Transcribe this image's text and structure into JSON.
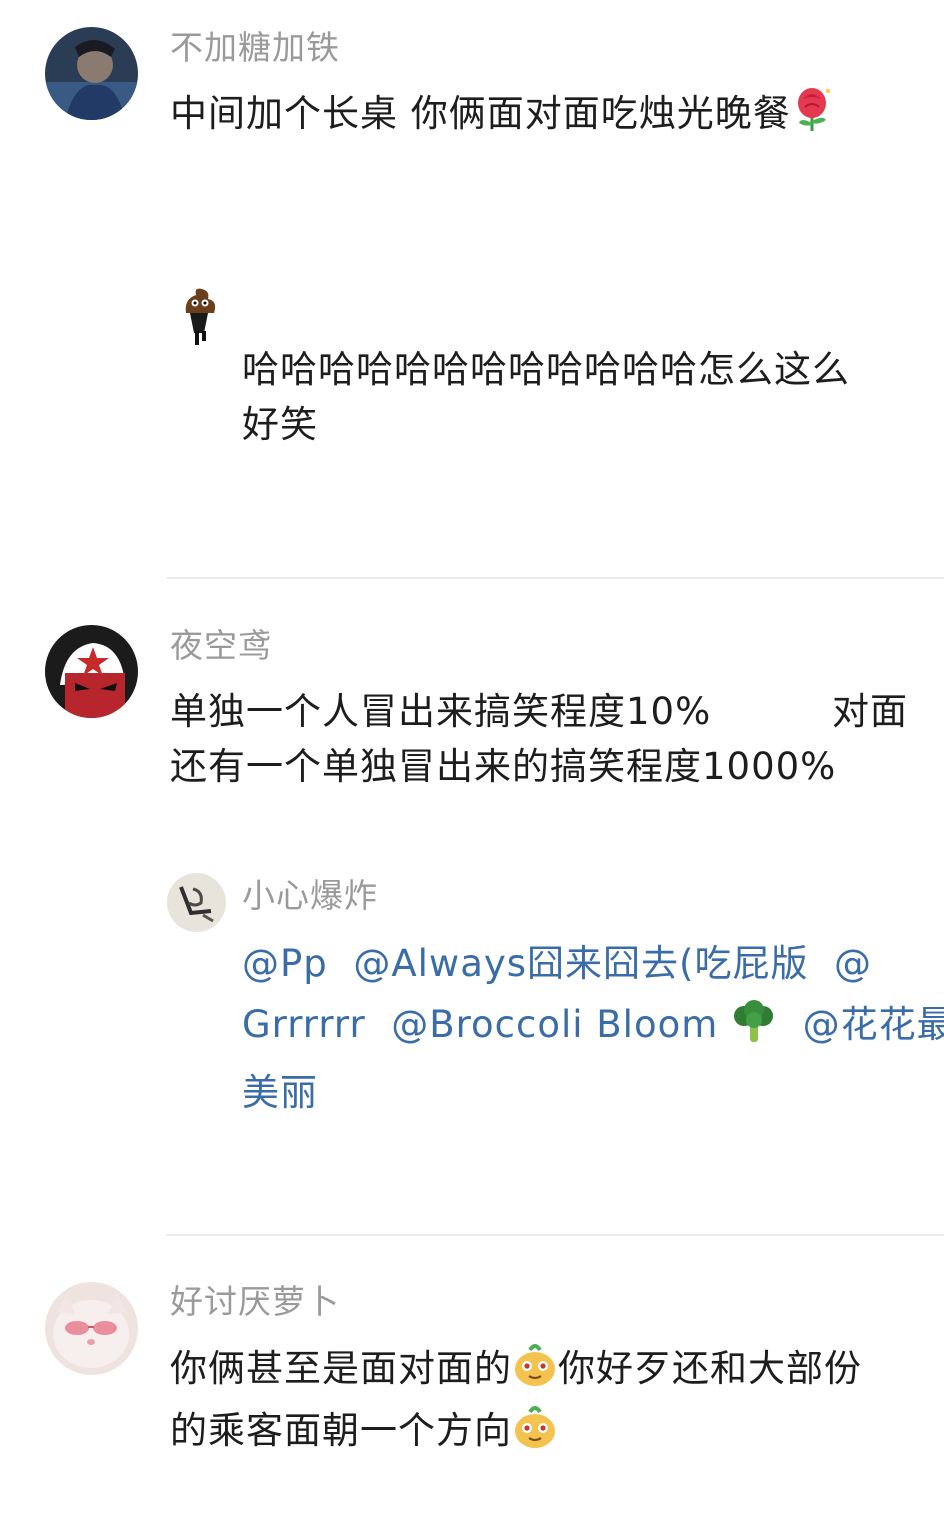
{
  "comments": [
    {
      "username": "不加糖加铁",
      "text": "中间加个长桌 你俩面对面吃烛光晚餐",
      "emoji": "rose-emoji",
      "reply": {
        "text_line1": "哈哈哈哈哈哈哈哈哈哈哈哈怎么这么",
        "text_line2": "好笑"
      }
    },
    {
      "username": "夜空鸢",
      "text_line1": "单独一个人冒出来搞笑程度10%",
      "text_line1_right": "对面",
      "text_line2": "还有一个单独冒出来的搞笑程度1000%",
      "reply": {
        "username": "小心爆炸",
        "m1": "@Pp",
        "m2": "@Always囧来囧去(吃屁版",
        "m3": "@",
        "m4": "Grrrrrr",
        "m5": "@Broccoli Bloom",
        "emoji": "broccoli-emoji",
        "m6": "@花花最",
        "m7": "美丽"
      }
    },
    {
      "username": "好讨厌萝卜",
      "text_line1": "你俩甚至是面对面的",
      "text_line1_after": "你好歹还和大部份",
      "text_line2": "的乘客面朝一个方向",
      "emoji": "smirk-face-emoji"
    }
  ],
  "colors": {
    "username": "#9a9a9a",
    "text": "#1d1d1d",
    "mention": "#3a6da8",
    "divider": "#ececec"
  }
}
